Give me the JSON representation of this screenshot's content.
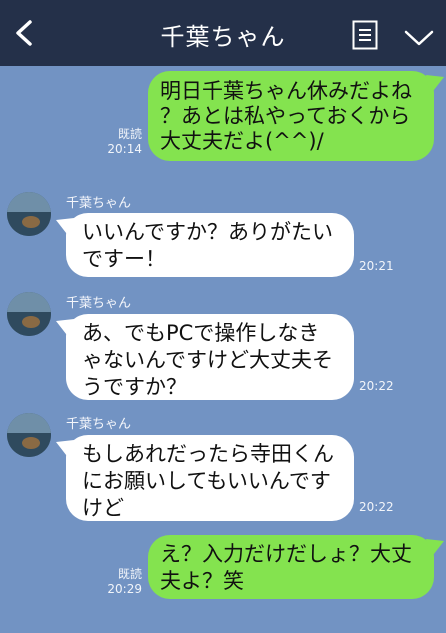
{
  "header": {
    "title": "千葉ちゃん"
  },
  "messages": [
    {
      "side": "out",
      "lines": [
        "明日千葉ちゃん休みだよね",
        "？あとは私やっておくから",
        "大丈夫だよ(^^)/"
      ],
      "read": "既読",
      "time": "20:14"
    },
    {
      "side": "in",
      "sender": "千葉ちゃん",
      "lines": [
        "いいんですか？ありがたい",
        "ですー！"
      ],
      "time": "20:21"
    },
    {
      "side": "in",
      "sender": "千葉ちゃん",
      "lines": [
        "あ、でもPCで操作しなき",
        "ゃないんですけど大丈夫そ",
        "うですか？"
      ],
      "time": "20:22"
    },
    {
      "side": "in",
      "sender": "千葉ちゃん",
      "lines": [
        "もしあれだったら寺田くん",
        "にお願いしてもいいんです",
        "けど"
      ],
      "time": "20:22"
    },
    {
      "side": "out",
      "lines": [
        "え？入力だけだしょ？大丈",
        "夫よ？笑"
      ],
      "read": "既読",
      "time": "20:29"
    }
  ],
  "colors": {
    "background": "#7293c3",
    "header": "#243049",
    "outgoing": "#84e34f",
    "incoming": "#ffffff"
  }
}
